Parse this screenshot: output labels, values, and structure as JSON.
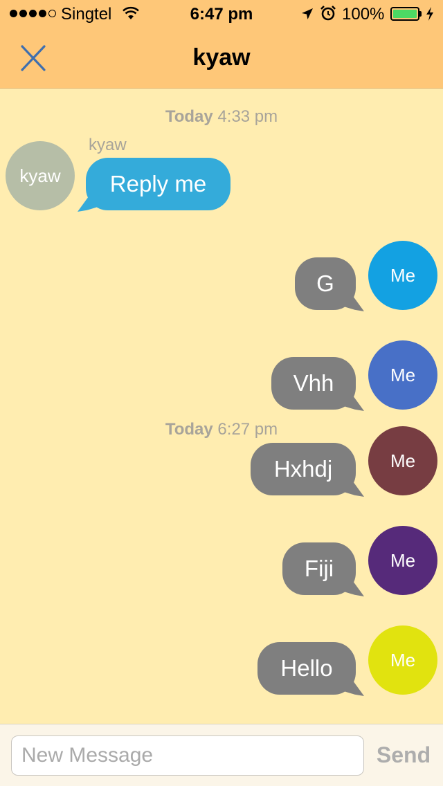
{
  "status_bar": {
    "signal_bars_filled": 4,
    "signal_bars_total": 5,
    "carrier": "Singtel",
    "time": "6:47 pm",
    "battery_percent": "100%",
    "battery_level": 1.0,
    "icons": [
      "wifi-icon",
      "location-arrow-icon",
      "alarm-clock-icon",
      "battery-icon",
      "charging-bolt-icon"
    ]
  },
  "header": {
    "close_icon": "close-icon",
    "title": "kyaw"
  },
  "colors": {
    "header_bg": "#FEC778",
    "chat_bg": "#FFEDB0",
    "incoming_bubble": "#34ABDA",
    "outgoing_bubble": "#7F7F7F",
    "battery_fill": "#4CD964"
  },
  "chat": {
    "timestamp_1": {
      "day": "Today",
      "time": "4:33 pm"
    },
    "timestamp_2": {
      "day": "Today",
      "time": "6:27 pm"
    },
    "messages": [
      {
        "direction": "incoming",
        "sender": "kyaw",
        "avatar_text": "kyaw",
        "avatar_color": "#B6BEA7",
        "text": "Reply me"
      },
      {
        "direction": "outgoing",
        "avatar_text": "Me",
        "avatar_color": "#13A1E2",
        "text": "G"
      },
      {
        "direction": "outgoing",
        "avatar_text": "Me",
        "avatar_color": "#4870C7",
        "text": "Vhh"
      },
      {
        "direction": "outgoing",
        "avatar_text": "Me",
        "avatar_color": "#773D42",
        "text": "Hxhdj"
      },
      {
        "direction": "outgoing",
        "avatar_text": "Me",
        "avatar_color": "#562A7A",
        "text": "Fiji"
      },
      {
        "direction": "outgoing",
        "avatar_text": "Me",
        "avatar_color": "#E1E30F",
        "text": "Hello"
      }
    ]
  },
  "composer": {
    "placeholder": "New Message",
    "value": "",
    "send_label": "Send"
  }
}
